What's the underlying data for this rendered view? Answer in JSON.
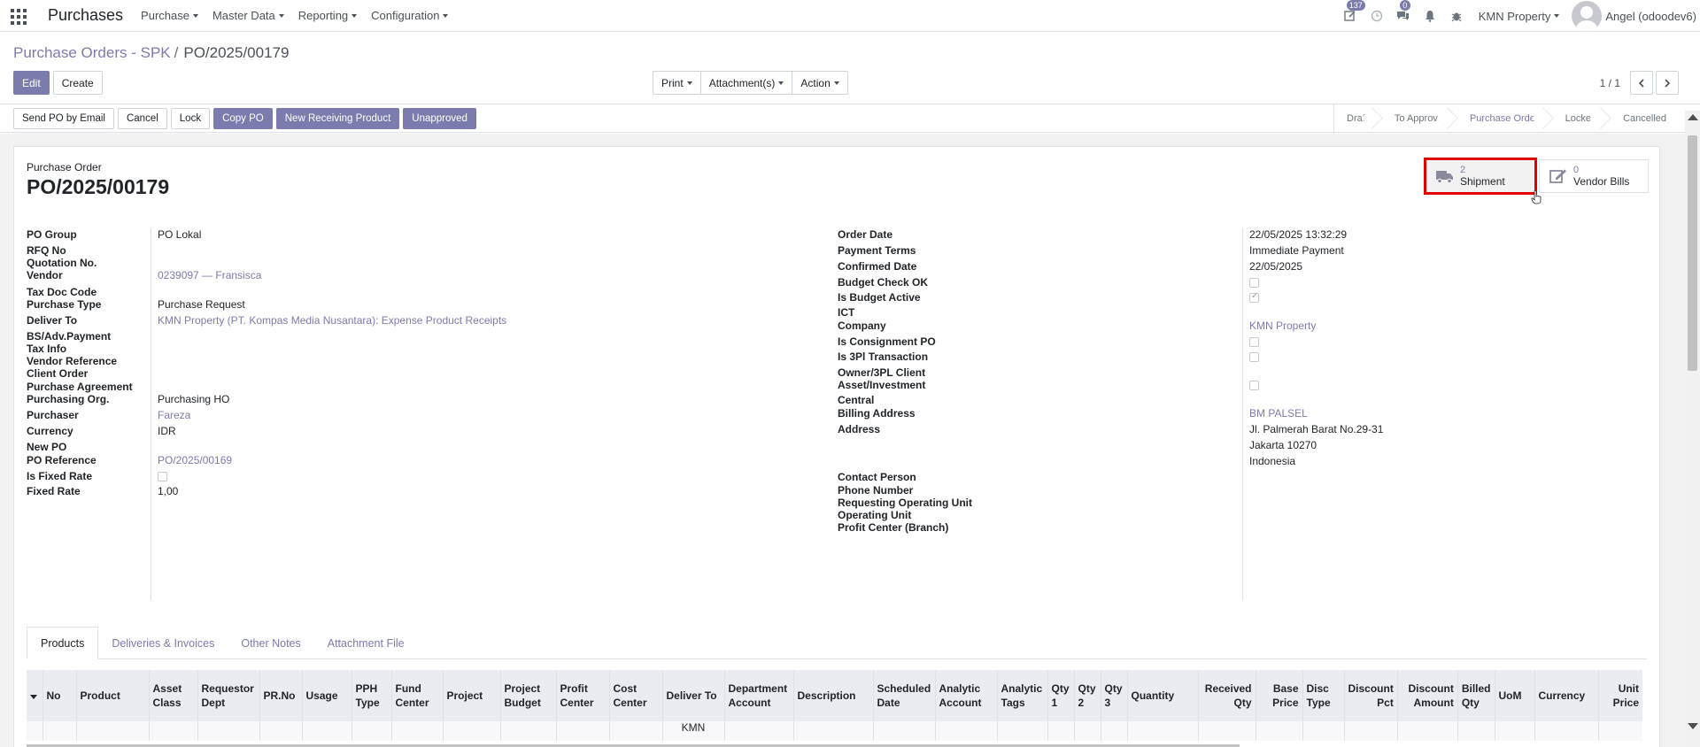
{
  "navbar": {
    "app_name": "Purchases",
    "menus": [
      "Purchase",
      "Master Data",
      "Reporting",
      "Configuration"
    ],
    "activity_badge": "137",
    "messages_badge": "0",
    "company": "KMN Property",
    "user": "Angel (odoodev6)"
  },
  "breadcrumb": {
    "parent": "Purchase Orders - SPK",
    "separator": "/",
    "current": "PO/2025/00179"
  },
  "control_panel": {
    "edit_label": "Edit",
    "create_label": "Create",
    "print_label": "Print",
    "attachments_label": "Attachment(s)",
    "action_label": "Action",
    "pager_value": "1 / 1"
  },
  "statusbar": {
    "buttons": [
      "Send PO by Email",
      "Cancel",
      "Lock",
      "Copy PO",
      "New Receiving Product",
      "Unapproved"
    ],
    "steps": [
      "Draft",
      "To Approve",
      "Purchase Order",
      "Locked",
      "Cancelled"
    ],
    "active_step": "Purchase Order"
  },
  "smart_buttons": {
    "shipment": {
      "count": "2",
      "label": "Shipment"
    },
    "vendor_bills": {
      "count": "0",
      "label": "Vendor Bills"
    }
  },
  "header": {
    "label": "Purchase Order",
    "name": "PO/2025/00179"
  },
  "left_fields": {
    "po_group": {
      "label": "PO Group",
      "value": "PO Lokal"
    },
    "rfq_no": {
      "label": "RFQ No",
      "value": ""
    },
    "quotation_no": {
      "label": "Quotation No.",
      "value": ""
    },
    "vendor": {
      "label": "Vendor",
      "value": "0239097 — Fransisca"
    },
    "tax_doc_code": {
      "label": "Tax Doc Code",
      "value": ""
    },
    "purchase_type": {
      "label": "Purchase Type",
      "value": "Purchase Request"
    },
    "deliver_to": {
      "label": "Deliver To",
      "value": "KMN Property (PT. Kompas Media Nusantara): Expense Product Receipts"
    },
    "bs_adv_payment": {
      "label": "BS/Adv.Payment",
      "value": ""
    },
    "tax_info": {
      "label": "Tax Info",
      "value": ""
    },
    "vendor_reference": {
      "label": "Vendor Reference",
      "value": ""
    },
    "client_order": {
      "label": "Client Order",
      "value": ""
    },
    "purchase_agreement": {
      "label": "Purchase Agreement",
      "value": ""
    },
    "purchasing_org": {
      "label": "Purchasing Org.",
      "value": "Purchasing HO"
    },
    "purchaser": {
      "label": "Purchaser",
      "value": "Fareza"
    },
    "currency": {
      "label": "Currency",
      "value": "IDR"
    },
    "new_po": {
      "label": "New PO",
      "value": ""
    },
    "po_reference": {
      "label": "PO Reference",
      "value": "PO/2025/00169"
    },
    "is_fixed_rate": {
      "label": "Is Fixed Rate",
      "checked": false
    },
    "fixed_rate": {
      "label": "Fixed Rate",
      "value": "1,00"
    }
  },
  "right_fields": {
    "order_date": {
      "label": "Order Date",
      "value": "22/05/2025 13:32:29"
    },
    "payment_terms": {
      "label": "Payment Terms",
      "value": "Immediate Payment"
    },
    "confirmed_date": {
      "label": "Confirmed Date",
      "value": "22/05/2025"
    },
    "budget_check_ok": {
      "label": "Budget Check OK",
      "checked": false
    },
    "is_budget_active": {
      "label": "Is Budget Active",
      "checked": true
    },
    "ict": {
      "label": "ICT",
      "value": ""
    },
    "company": {
      "label": "Company",
      "value": "KMN Property"
    },
    "is_consignment_po": {
      "label": "Is Consignment PO",
      "checked": false
    },
    "is_3pl_transaction": {
      "label": "Is 3Pl Transaction",
      "checked": false
    },
    "owner_3pl_client": {
      "label": "Owner/3PL Client",
      "value": ""
    },
    "asset_investment": {
      "label": "Asset/Investment",
      "checked": false
    },
    "central": {
      "label": "Central",
      "value": ""
    },
    "billing_address": {
      "label": "Billing Address",
      "value": "BM PALSEL"
    },
    "address": {
      "label": "Address",
      "line1": "Jl. Palmerah Barat No.29-31",
      "line2": "Jakarta  10270",
      "line3": "Indonesia"
    },
    "contact_person": {
      "label": "Contact Person",
      "value": ""
    },
    "phone_number": {
      "label": "Phone Number",
      "value": ""
    },
    "requesting_operating_unit": {
      "label": "Requesting Operating Unit",
      "value": ""
    },
    "operating_unit": {
      "label": "Operating Unit",
      "value": ""
    },
    "profit_center": {
      "label": "Profit Center (Branch)",
      "value": ""
    }
  },
  "tabs": [
    "Products",
    "Deliveries & Invoices",
    "Other Notes",
    "Attachment File"
  ],
  "active_tab": "Products",
  "table": {
    "columns": [
      "No",
      "Product",
      "Asset Class",
      "Requestor Dept",
      "PR.No",
      "Usage",
      "PPH Type",
      "Fund Center",
      "Project",
      "Project Budget",
      "Profit Center",
      "Cost Center",
      "Deliver To",
      "Department Account",
      "Description",
      "Scheduled Date",
      "Analytic Account",
      "Analytic Tags",
      "Qty 1",
      "Qty 2",
      "Qty 3",
      "Quantity",
      "Received Qty",
      "Base Price",
      "Disc Type",
      "Discount Pct",
      "Discount Amount",
      "Billed Qty",
      "UoM",
      "Currency",
      "Unit Price"
    ],
    "first_row_partial": "KMN"
  },
  "colors": {
    "primary": "#7c7bad",
    "highlight_box": "#e00000"
  }
}
